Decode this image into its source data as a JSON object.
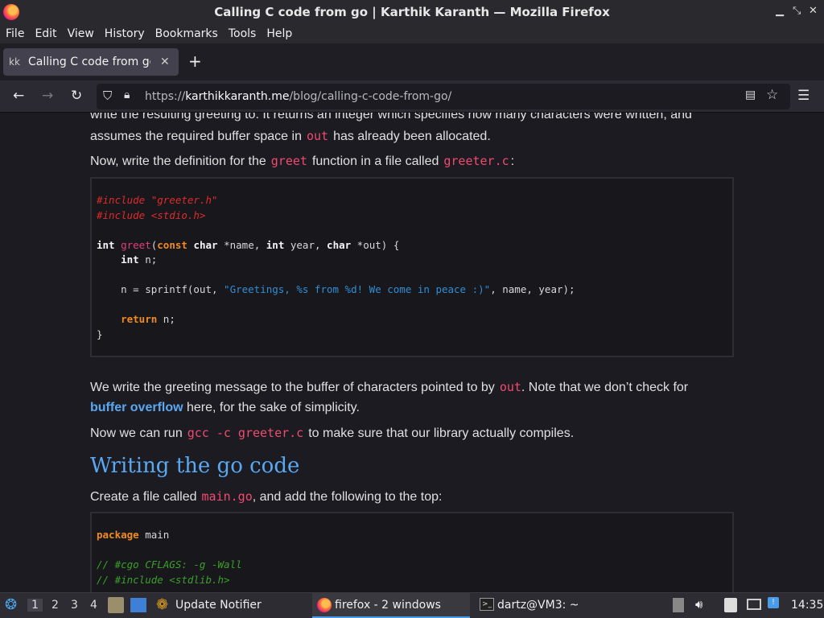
{
  "window": {
    "title": "Calling C code from go | Karthik Karanth — Mozilla Firefox"
  },
  "menu": [
    "File",
    "Edit",
    "View",
    "History",
    "Bookmarks",
    "Tools",
    "Help"
  ],
  "tab": {
    "favicon": "kk",
    "label": "Calling C code from go",
    "close": "✕"
  },
  "url": {
    "scheme": "https://",
    "host": "karthikkaranth.me",
    "path": "/blog/calling-c-code-from-go/"
  },
  "article": {
    "line1": "write the resulting greeting to. It returns an integer which specifies how many characters were written, and",
    "line2_a": "assumes the required buffer space in",
    "line2_code": "out",
    "line2_b": "has already been allocated.",
    "line3_a": "Now, write the definition for the",
    "line3_code1": "greet",
    "line3_b": "function in a file called",
    "line3_code2": "greeter.c",
    "line3_c": ":",
    "code1": {
      "l1": "#include \"greeter.h\"",
      "l2": "#include <stdio.h>",
      "l4_int": "int",
      "l4_fn": "greet",
      "l4_const": "const",
      "l4_char": "char",
      "l4_a": " *name, ",
      "l4_int2": "int",
      "l4_b": " year, ",
      "l4_char2": "char",
      "l4_c": " *out) {",
      "l5_int": "int",
      "l5_rest": " n;",
      "l7_a": "    n = sprintf(out, ",
      "l7_str": "\"Greetings, %s from %d! We come in peace :)\"",
      "l7_b": ", name, year);",
      "l9_return": "return",
      "l9_rest": " n;",
      "l10": "}"
    },
    "para2_a": "We write the greeting message to the buffer of characters pointed to by",
    "para2_code": "out",
    "para2_b": ". Note that we don’t check for",
    "para2_link": "buffer overflow",
    "para2_c": " here, for the sake of simplicity.",
    "para3_a": "Now we can run",
    "para3_code": "gcc -c greeter.c",
    "para3_b": "to make sure that our library actually compiles.",
    "heading": "Writing the go code",
    "para4_a": "Create a file called",
    "para4_code": "main.go",
    "para4_b": ", and add the following to the top:",
    "code2": {
      "l1_kw": "package",
      "l1_rest": " main",
      "l3": "// #cgo CFLAGS: -g -Wall",
      "l4": "// #include <stdlib.h>"
    }
  },
  "taskbar": {
    "workspaces": [
      "1",
      "2",
      "3",
      "4"
    ],
    "update_notifier": "Update Notifier",
    "firefox": "firefox - 2 windows",
    "terminal": "dartz@VM3: ~",
    "clock": "14:35"
  },
  "colors": {
    "accent_link": "#5aa8f0",
    "inline_code": "#f04b6e",
    "background": "#1c1b22"
  }
}
